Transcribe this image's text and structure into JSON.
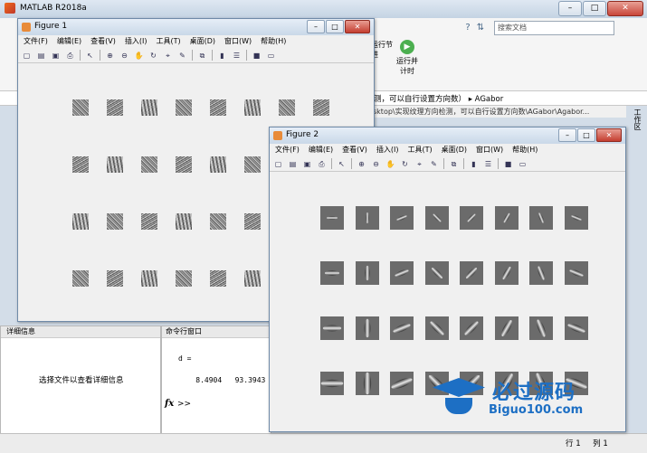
{
  "main": {
    "title": "MATLAB R2018a",
    "search_placeholder": "搜索文档",
    "run_section": "运行节\n进",
    "run_time_label": "运行并\n计时",
    "path_text": "测，可以自行设置方向数） ▸ AGabor",
    "path_text2": "sktop\\实现纹理方向检测，可以自行设置方向数\\AGabor\\Agabor...",
    "workspace_label": "工作区",
    "detail_header": "详细信息",
    "detail_message": "选择文件以查看详细信息",
    "cmd_header": "命令行窗口",
    "cmd_output": "d =\n\n    8.4904   93.3943",
    "cmd_prompt_icon": "fx",
    "cmd_prompt": ">>",
    "status_line_label": "行",
    "status_line": "1",
    "status_col_label": "列",
    "status_col": "1"
  },
  "figure1": {
    "title": "Figure 1",
    "menu": [
      "文件(F)",
      "编辑(E)",
      "查看(V)",
      "插入(I)",
      "工具(T)",
      "桌面(D)",
      "窗口(W)",
      "帮助(H)"
    ],
    "grid_rows": 4,
    "grid_cols": 8
  },
  "figure2": {
    "title": "Figure 2",
    "menu": [
      "文件(F)",
      "编辑(E)",
      "查看(V)",
      "插入(I)",
      "工具(T)",
      "桌面(D)",
      "窗口(W)",
      "帮助(H)"
    ],
    "grid_rows": 4,
    "grid_cols": 8
  },
  "window_buttons": {
    "minimize": "–",
    "maximize": "□",
    "close": "✕"
  },
  "watermark": {
    "brand": "必过源码",
    "url": "Biguo100.com"
  }
}
